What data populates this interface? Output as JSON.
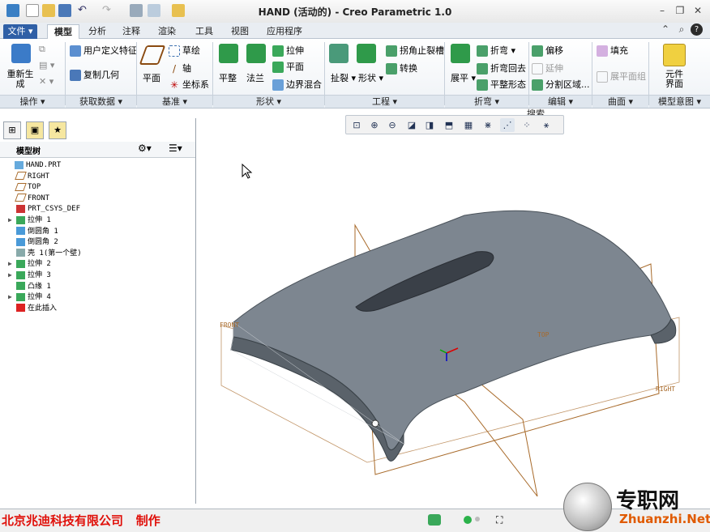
{
  "window": {
    "title": "HAND (活动的) - Creo Parametric 1.0"
  },
  "tabs": [
    "文件",
    "模型",
    "分析",
    "注释",
    "渲染",
    "工具",
    "视图",
    "应用程序"
  ],
  "active_tab": "模型",
  "ribbon": {
    "operations": {
      "regen": "重新生成",
      "group": "操作"
    },
    "get_data": {
      "user_feature": "用户定义特征",
      "copy_geom": "复制几何",
      "group": "获取数据"
    },
    "datum": {
      "plane": "平面",
      "sketch": "草绘",
      "axis": "轴",
      "csys": "坐标系",
      "group": "基准"
    },
    "shapes": {
      "flat": "平整",
      "flange": "法兰",
      "extrude": "拉伸",
      "plane": "平面",
      "blend": "边界混合",
      "group": "形状"
    },
    "engineering": {
      "rip": "扯裂",
      "form": "形状",
      "corner_relief": "拐角止裂槽",
      "convert": "转换",
      "group": "工程"
    },
    "bend": {
      "unbend": "展平",
      "bend": "折弯",
      "bend_back": "折弯回去",
      "flat_state": "平整形态",
      "group": "折弯"
    },
    "editing": {
      "offset": "偏移",
      "extend": "延伸",
      "split": "分割区域...",
      "group": "编辑"
    },
    "surfaces": {
      "fill": "填充",
      "expand": "展平面组",
      "group": "曲面"
    },
    "intent": {
      "component": "元件界面",
      "group": "模型意图"
    },
    "search": "搜索..."
  },
  "model_tree": {
    "header": "模型树",
    "items": [
      {
        "label": "HAND.PRT",
        "expand": "",
        "type": "part"
      },
      {
        "label": "RIGHT",
        "expand": "",
        "type": "plane"
      },
      {
        "label": "TOP",
        "expand": "",
        "type": "plane"
      },
      {
        "label": "FRONT",
        "expand": "",
        "type": "plane"
      },
      {
        "label": "PRT_CSYS_DEF",
        "expand": "",
        "type": "csys"
      },
      {
        "label": "拉伸 1",
        "expand": "▶",
        "type": "extrude"
      },
      {
        "label": "倒圆角 1",
        "expand": "",
        "type": "round"
      },
      {
        "label": "倒圆角 2",
        "expand": "",
        "type": "round"
      },
      {
        "label": "壳 1(第一个壁)",
        "expand": "",
        "type": "shell"
      },
      {
        "label": "拉伸 2",
        "expand": "▶",
        "type": "extrude"
      },
      {
        "label": "拉伸 3",
        "expand": "▶",
        "type": "extrude"
      },
      {
        "label": "凸缘 1",
        "expand": "",
        "type": "flange"
      },
      {
        "label": "拉伸 4",
        "expand": "▶",
        "type": "extrude"
      },
      {
        "label": "在此插入",
        "expand": "",
        "type": "insert"
      }
    ]
  },
  "viewport": {
    "datum_labels": [
      "FRONT",
      "TOP",
      "RIGHT"
    ]
  },
  "watermark": {
    "company": "北京兆迪科技有限公司",
    "suffix": "制作"
  },
  "logo": {
    "text": "专职网",
    "url": "Zhuanzhi.Net"
  }
}
